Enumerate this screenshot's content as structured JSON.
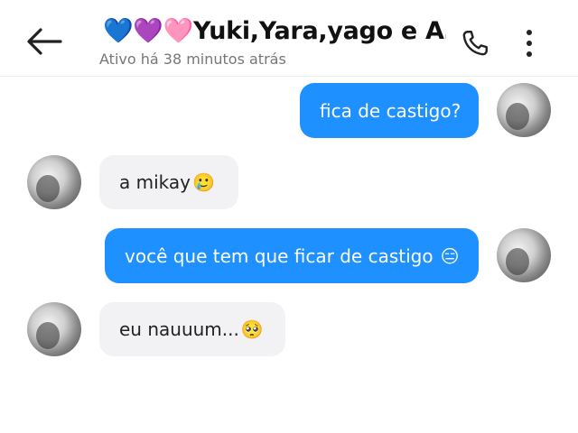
{
  "header": {
    "title": "💙💜🩷Yuki,Yara,yago e A…",
    "status": "Ativo há 38 minutos atrás"
  },
  "messages": [
    {
      "direction": "out",
      "text": "fica de castigo?"
    },
    {
      "direction": "in",
      "text": "a mikay",
      "emoji": "🥲"
    },
    {
      "direction": "out",
      "text": "você que tem que ficar de castigo",
      "emoji": "😑"
    },
    {
      "direction": "in",
      "text": "eu nauuum...",
      "emoji": "🥺"
    }
  ],
  "colors": {
    "outgoing_bubble": "#1e90ff",
    "incoming_bubble": "#f2f2f5"
  },
  "icons": [
    "back-arrow-icon",
    "phone-icon",
    "more-vert-icon",
    "avatar"
  ]
}
